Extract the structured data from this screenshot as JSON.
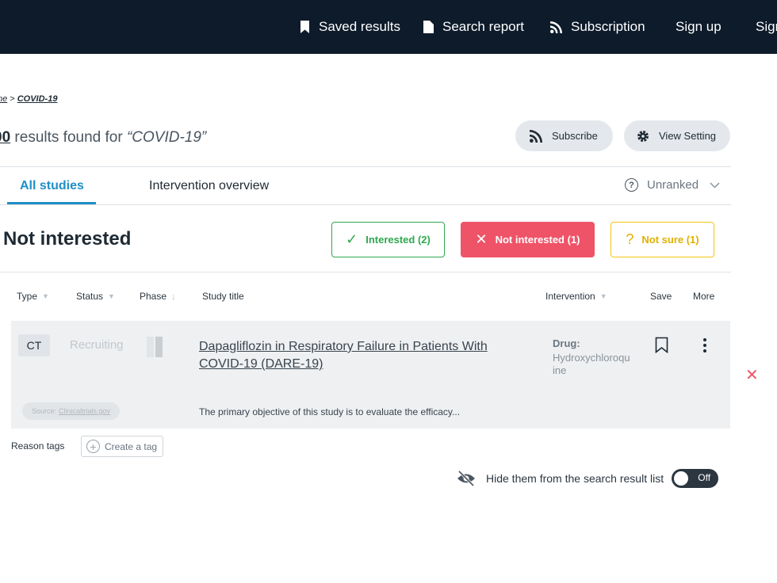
{
  "nav": {
    "saved_results": "Saved results",
    "search_report": "Search report",
    "subscription": "Subscription",
    "sign_up": "Sign up",
    "sign_in_partial": "Sign"
  },
  "breadcrumb": {
    "home": "me",
    "separator": ">",
    "current": "COVID-19"
  },
  "results": {
    "count_partial": "00",
    "text": " results found for ",
    "query": "“COVID-19”"
  },
  "actions": {
    "subscribe": "Subscribe",
    "view_setting": "View Setting"
  },
  "tabs": {
    "all_studies": "All studies",
    "intervention_overview": "Intervention overview"
  },
  "ranking": {
    "label": "Unranked"
  },
  "section": {
    "title": "Not interested"
  },
  "filters": {
    "interested": "Interested (2)",
    "not_interested": "Not interested (1)",
    "not_sure": "Not sure (1)"
  },
  "columns": {
    "type": "Type",
    "status": "Status",
    "phase": "Phase",
    "study_title": "Study title",
    "intervention": "Intervention",
    "save": "Save",
    "more": "More"
  },
  "study": {
    "type": "CT",
    "status": "Recruiting",
    "title": "Dapagliflozin in Respiratory Failure in Patients With COVID-19 (DARE-19)",
    "intervention_label": "Drug:",
    "intervention_value": "Hydroxychloroquine",
    "source_prefix": "Source:",
    "source_link": "Clinicaltrials.gov",
    "summary": "The primary objective of this study is to evaluate the efficacy..."
  },
  "reason_tags": {
    "label": "Reason tags",
    "create": "Create a tag"
  },
  "hide": {
    "label": "Hide them from the search result list",
    "toggle": "Off"
  },
  "colors": {
    "nav_bg": "#0d1b2a",
    "accent": "#1f8fc6",
    "interested": "#2fa84f",
    "not_interested": "#ef5368",
    "not_sure": "#f2c511"
  }
}
